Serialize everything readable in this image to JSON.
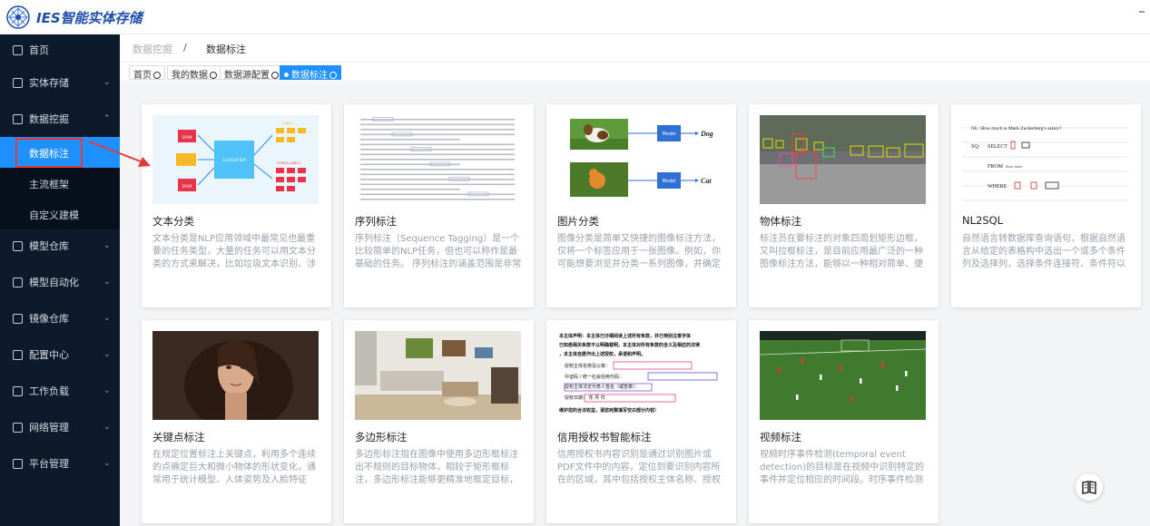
{
  "app": {
    "title": "IES智能实体存储"
  },
  "sidebar": {
    "items": [
      {
        "label": "首页",
        "icon": "dashboard-icon",
        "has_children": false
      },
      {
        "label": "实体存储",
        "icon": "storage-icon",
        "has_children": true
      },
      {
        "label": "数据挖掘",
        "icon": "chart-icon",
        "has_children": true,
        "expanded": true
      },
      {
        "label": "模型仓库",
        "icon": "box-icon",
        "has_children": true
      },
      {
        "label": "模型自动化",
        "icon": "branch-icon",
        "has_children": true
      },
      {
        "label": "镜像仓库",
        "icon": "image-repo-icon",
        "has_children": true
      },
      {
        "label": "配置中心",
        "icon": "settings-panel-icon",
        "has_children": true
      },
      {
        "label": "工作负载",
        "icon": "workload-icon",
        "has_children": true
      },
      {
        "label": "网络管理",
        "icon": "globe-icon",
        "has_children": true
      },
      {
        "label": "平台管理",
        "icon": "gear-icon",
        "has_children": true
      }
    ],
    "subitems": [
      {
        "label": "数据标注",
        "active": true
      },
      {
        "label": "主流框架",
        "active": false
      },
      {
        "label": "自定义建模",
        "active": false
      }
    ]
  },
  "breadcrumb": {
    "parent": "数据挖掘",
    "separator": "/",
    "current": "数据标注"
  },
  "tabs": [
    {
      "label": "首页",
      "active": false
    },
    {
      "label": "我的数据",
      "active": false
    },
    {
      "label": "数据源配置",
      "active": false
    },
    {
      "label": "数据标注",
      "active": true
    }
  ],
  "cards": [
    {
      "title": "文本分类",
      "desc": "文本分类是NLP应用领域中最常见也最重要的任务类型，大量的任务可以用文本分类的方式来解决，比如垃圾文本识别、涉黄涉..."
    },
    {
      "title": "序列标注",
      "desc": "序列标注（Sequence Tagging）是一个比较简单的NLP任务，但也可以称作是最基础的任务。 序列标注的涵盖范围是非常广泛的..."
    },
    {
      "title": "图片分类",
      "desc": "图像分类是简单又快捷的图像标注方法，仅将一个标签应用于一张图像。例如，你可能想要浏览并分类一系列图像，并确定哪些..."
    },
    {
      "title": "物体标注",
      "desc": "标注员在要标注的对象四周划矩形边框，又叫拉框标注，是目前应用最广泛的一种图像标注方法，能够以一种相对简单、便捷的..."
    },
    {
      "title": "NL2SQL",
      "desc": "自然语言转数据库查询语句，根据自然语言从给定的表格构中选出一个或多个条件列及选择列，选择条件连接符、条件符以及从..."
    },
    {
      "title": "关键点标注",
      "desc": "在规定位置标注上关键点，利用多个连续的点确定巨大和微小物体的形状变化，通常用于统计模型、人体姿势及人脸特征点、人..."
    },
    {
      "title": "多边形标注",
      "desc": "多边形标注指在图像中使用多边形框标注出不规则的目标物体，相较于矩形框标注，多边形标注能够更精准地框定目标，使标注..."
    },
    {
      "title": "信用授权书智能标注",
      "desc": "信用授权书内容识别是通过识别图片或PDF文件中的内容，定位到要识别内容所在的区域，其中包括授权主体名称、授权主体公..."
    },
    {
      "title": "视频标注",
      "desc": "视频时序事件检测(temporal event detection)的目标是在视频中识别特定的事件并定位相应的时间段。时序事件检测作为..."
    }
  ],
  "thumbs": {
    "text_classification": {
      "center_label": "CLASSIFIER",
      "right_top_label": "LABEL1",
      "right_bottom_label": "OTHER LABEL2",
      "left_labels": [
        "SPAM",
        "",
        "SPAM"
      ]
    },
    "image_classification": {
      "model_label": "Model",
      "out1": "Dog",
      "out2": "Cat"
    },
    "nl2sql": {
      "line1": "NL:  How much is Mark Zuckerberg's salary?",
      "sq": "SQ:",
      "select": "SELECT",
      "from": "FROM",
      "from_val": "Base table",
      "where": "WHERE"
    },
    "credit_doc": {
      "lines": [
        "本主体声明：本主体已仔细阅读上述所有条款，并已特别注意字体",
        "已知悉相关条款不以明确载明，本主体对所有条款的含义及相应的法律",
        "，本主体自愿作出上述授权，承诺和声明。",
        "授权主体名称及公章：",
        "中证码 / 统一社会信用代码：",
        "授权主体法定代表人签名（或签章）：",
        "授权日期：        年    月    日",
        "维护您的合法权益，请您完整填写空白部分内容）"
      ]
    }
  },
  "colors": {
    "sidebar_bg": "#0d1a2b",
    "accent": "#1e90ff",
    "highlight": "#e23b3b",
    "brand": "#1e4ea8"
  }
}
